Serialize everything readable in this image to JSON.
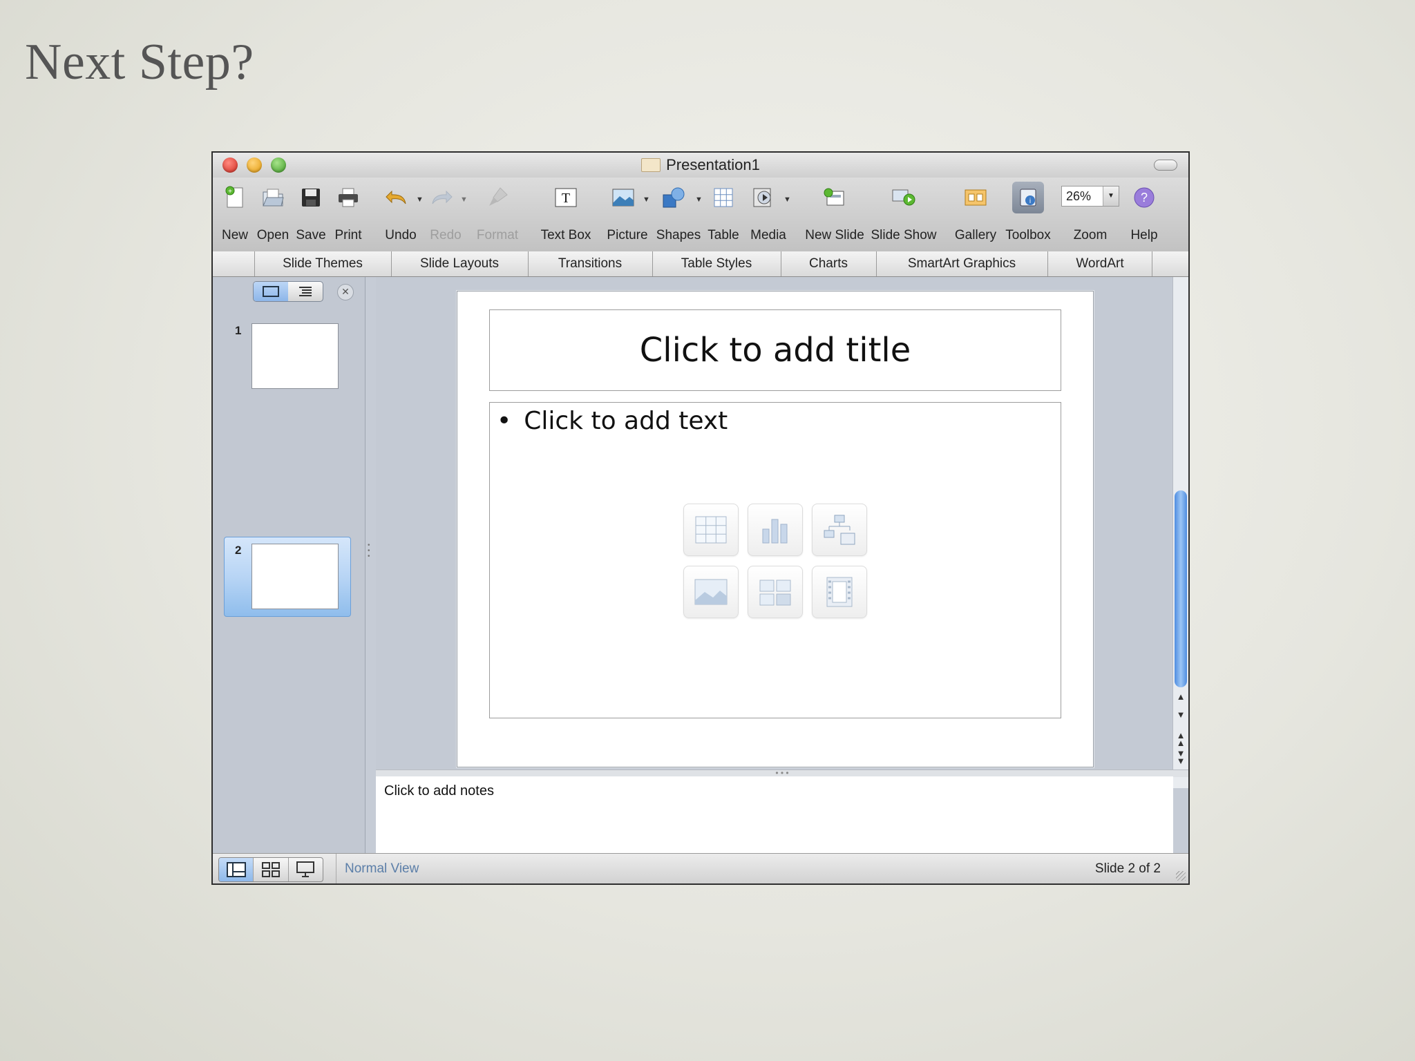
{
  "slide_heading": "Next Step?",
  "window": {
    "title": "Presentation1"
  },
  "toolbar": {
    "new": "New",
    "open": "Open",
    "save": "Save",
    "print": "Print",
    "undo": "Undo",
    "redo": "Redo",
    "format": "Format",
    "text_box": "Text Box",
    "picture": "Picture",
    "shapes": "Shapes",
    "table": "Table",
    "media": "Media",
    "new_slide": "New Slide",
    "slide_show": "Slide Show",
    "gallery": "Gallery",
    "toolbox": "Toolbox",
    "zoom_label": "Zoom",
    "zoom_value": "26%",
    "help": "Help"
  },
  "ribbon": {
    "tabs": [
      "Slide Themes",
      "Slide Layouts",
      "Transitions",
      "Table Styles",
      "Charts",
      "SmartArt Graphics",
      "WordArt"
    ]
  },
  "thumbnails": [
    {
      "number": "1"
    },
    {
      "number": "2",
      "selected": true
    }
  ],
  "slide": {
    "title_placeholder": "Click to add title",
    "body_placeholder": "Click to add text",
    "bullet": "•"
  },
  "notes": {
    "placeholder": "Click to add notes"
  },
  "status": {
    "view": "Normal View",
    "slide_position": "Slide 2 of 2"
  },
  "colors": {
    "accent": "#4f8de0",
    "status_view_text": "#5b7ea8",
    "background": "#e6e6df"
  }
}
